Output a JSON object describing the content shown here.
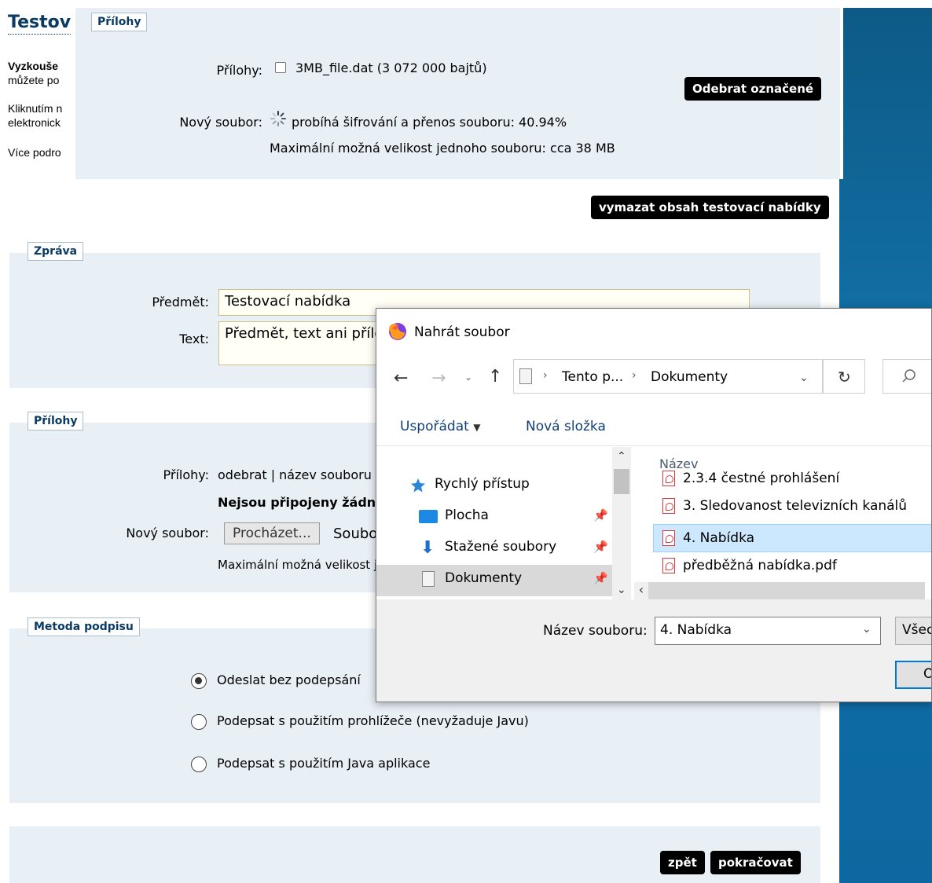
{
  "page": {
    "title": "Testov",
    "intro_line1_bold": "Vyzkouše",
    "intro_line2": "můžete po",
    "intro_line3": "Kliknutím n",
    "intro_line4": "elektronick",
    "intro_line5": "Více podro"
  },
  "top_attachments": {
    "legend": "Přílohy",
    "label_attachments": "Přílohy:",
    "file_name": "3MB_file.dat (3 072 000 bajtů)",
    "label_new_file": "Nový soubor:",
    "progress_text": "probíhá šifrování a přenos souboru: 40.94%",
    "progress_percent": 40.94,
    "max_size": "Maximální možná velikost jednoho souboru: cca 38 MB",
    "remove_button": "Odebrat označené"
  },
  "clear_button": "vymazat obsah testovací nabídky",
  "message": {
    "legend": "Zpráva",
    "subject_label": "Předmět:",
    "subject_value": "Testovací nabídka",
    "text_label": "Text:",
    "text_value": "Předmět, text ani přílo"
  },
  "attachments": {
    "legend": "Přílohy",
    "label": "Přílohy:",
    "header": "odebrat | název souboru",
    "none_text": "Nejsou připojeny žádn",
    "new_file_label": "Nový soubor:",
    "browse_button": "Procházet...",
    "no_file_text": "Soubo",
    "max_size": "Maximální možná velikost j"
  },
  "signature": {
    "legend": "Metoda podpisu",
    "options": [
      {
        "label": "Odeslat bez podepsání",
        "selected": true
      },
      {
        "label": "Podepsat s použitím prohlížeče (nevyžaduje Javu)",
        "selected": false
      },
      {
        "label": "Podepsat s použitím Java aplikace",
        "selected": false
      }
    ]
  },
  "footer": {
    "back_button": "zpět",
    "continue_button": "pokračovat"
  },
  "dialog": {
    "title": "Nahrát soubor",
    "breadcrumb_1": "Tento p...",
    "breadcrumb_2": "Dokumenty",
    "organize": "Uspořádat",
    "new_folder": "Nová složka",
    "nav_items": [
      "Rychlý přístup",
      "Plocha",
      "Stažené soubory",
      "Dokumenty"
    ],
    "column_name": "Název",
    "files": [
      "2.3.4 čestné prohlášení",
      "3. Sledovanost televizních kanálů",
      "4. Nabídka",
      "předběžná nabídka.pdf"
    ],
    "selected_file_index": 2,
    "filename_label": "Název souboru:",
    "filename_value": "4. Nabídka",
    "filter_label": "Všech",
    "open_button_fragment": "O"
  },
  "colors": {
    "panel_bg": "#e8eff5",
    "legend_text": "#0b3b63",
    "button_bg": "#000000",
    "side_strip": "#0d5a86",
    "selected_row": "#cce8ff"
  }
}
